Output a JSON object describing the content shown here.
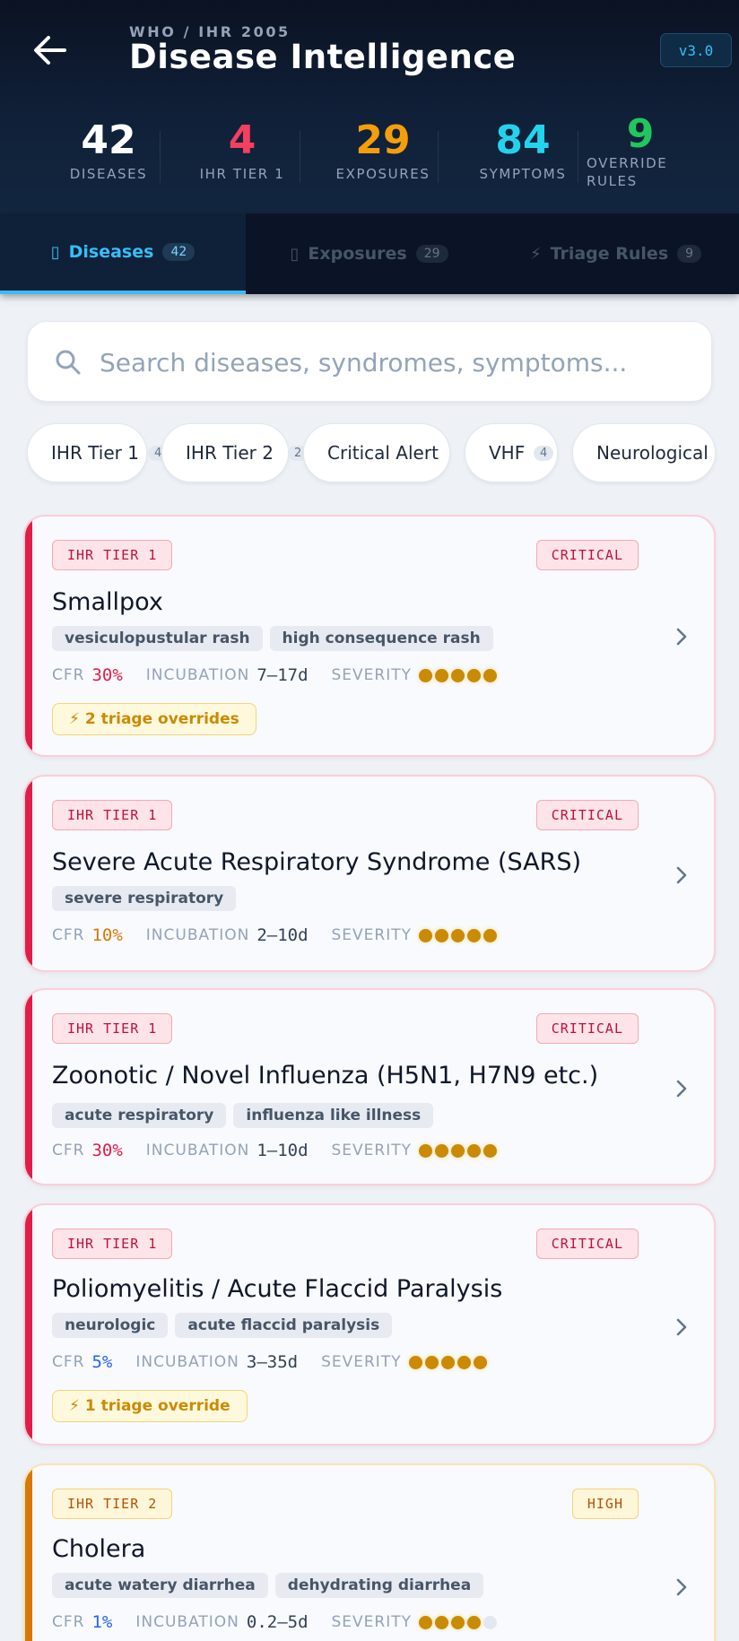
{
  "header": {
    "kicker": "WHO / IHR 2005",
    "title": "Disease Intelligence",
    "version": "v3.0"
  },
  "stats": [
    {
      "value": "42",
      "label": "DISEASES",
      "color": "#ffffff"
    },
    {
      "value": "4",
      "label": "IHR TIER 1",
      "color": "#f43f5e"
    },
    {
      "value": "29",
      "label": "EXPOSURES",
      "color": "#f59e0b"
    },
    {
      "value": "84",
      "label": "SYMPTOMS",
      "color": "#22d3ee"
    },
    {
      "value": "9",
      "label_line1": "OVERRIDE",
      "label_line2": "RULES",
      "color": "#22c55e"
    }
  ],
  "tabs": [
    {
      "icon": "▯",
      "label": "Diseases",
      "count": "42"
    },
    {
      "icon": "▯",
      "label": "Exposures",
      "count": "29"
    },
    {
      "icon": "⚡",
      "label": "Triage Rules",
      "count": "9"
    }
  ],
  "search": {
    "placeholder": "Search diseases, syndromes, symptoms..."
  },
  "chips": [
    {
      "label": "IHR Tier 1",
      "count": "4"
    },
    {
      "label": "IHR Tier 2",
      "count": "2"
    },
    {
      "label": "Critical Alert",
      "count": ""
    },
    {
      "label": "VHF",
      "count": "4"
    },
    {
      "label": "Neurological",
      "count": ""
    }
  ],
  "labels": {
    "cfr": "CFR",
    "incubation": "INCUBATION",
    "severity": "SEVERITY"
  },
  "colors": {
    "cfr_high": "#e11d48",
    "cfr_mid": "#d97706",
    "cfr_low": "#2563eb"
  },
  "diseases": [
    {
      "tier": "IHR TIER 1",
      "alert": "CRITICAL",
      "name": "Smallpox",
      "syndromes": [
        "vesiculopustular rash",
        "high consequence rash"
      ],
      "cfr": "30%",
      "incubation": "7–17d",
      "severity": 5,
      "override": "⚡ 2 triage overrides"
    },
    {
      "tier": "IHR TIER 1",
      "alert": "CRITICAL",
      "name": "Severe Acute Respiratory Syndrome (SARS)",
      "syndromes": [
        "severe respiratory"
      ],
      "cfr": "10%",
      "incubation": "2–10d",
      "severity": 5,
      "override": ""
    },
    {
      "tier": "IHR TIER 1",
      "alert": "CRITICAL",
      "name": "Zoonotic / Novel Influenza (H5N1, H7N9 etc.)",
      "syndromes": [
        "acute respiratory",
        "influenza like illness"
      ],
      "cfr": "30%",
      "incubation": "1–10d",
      "severity": 5,
      "override": ""
    },
    {
      "tier": "IHR TIER 1",
      "alert": "CRITICAL",
      "name": "Poliomyelitis / Acute Flaccid Paralysis",
      "syndromes": [
        "neurologic",
        "acute flaccid paralysis"
      ],
      "cfr": "5%",
      "incubation": "3–35d",
      "severity": 5,
      "override": "⚡ 1 triage override"
    },
    {
      "tier": "IHR TIER 2",
      "alert": "HIGH",
      "name": "Cholera",
      "syndromes": [
        "acute watery diarrhea",
        "dehydrating diarrhea"
      ],
      "cfr": "1%",
      "incubation": "0.2–5d",
      "severity": 4,
      "override": ""
    }
  ]
}
